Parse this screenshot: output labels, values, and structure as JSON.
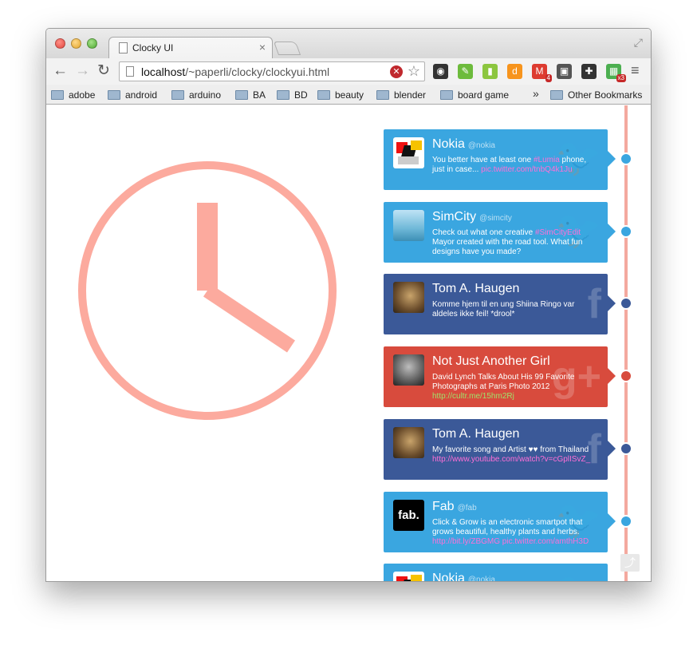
{
  "browser": {
    "tab_title": "Clocky UI",
    "url_host": "localhost",
    "url_path": "/~paperli/clocky/clockyui.html",
    "tab_close": "×",
    "nav": {
      "back": "←",
      "forward": "→",
      "reload": "↻"
    },
    "star": "☆",
    "more_bookmarks": "»"
  },
  "bookmarks": [
    "adobe",
    "android",
    "arduino",
    "BA",
    "BD",
    "beauty",
    "blender",
    "board game",
    "Other Bookmarks"
  ],
  "extensions": [
    {
      "name": "camera-icon",
      "color": "#333333",
      "glyph": "◉"
    },
    {
      "name": "evernote-feed-icon",
      "color": "#6dbb3c",
      "glyph": "✎"
    },
    {
      "name": "bar-icon",
      "color": "#8cc63f",
      "glyph": "▮"
    },
    {
      "name": "d-icon",
      "color": "#f7941d",
      "glyph": "d"
    },
    {
      "name": "gmail-icon",
      "color": "#dd3b30",
      "glyph": "M",
      "badge": "4"
    },
    {
      "name": "screenshot-icon",
      "color": "#555555",
      "glyph": "▣"
    },
    {
      "name": "puzzle-icon",
      "color": "#333333",
      "glyph": "✚"
    },
    {
      "name": "palette-icon",
      "color": "#4caf50",
      "glyph": "▦",
      "badge": "x3"
    }
  ],
  "clock": {
    "color": "#fcaa9e",
    "hour_angle": 135,
    "minute_angle": 0
  },
  "posts": [
    {
      "network": "twitter",
      "color": "#3aa6e0",
      "name": "Nokia",
      "handle": "@nokia",
      "text_before": "You better have at least one ",
      "text_hl": "#Lumia",
      "text_after": " phone, just in case... ",
      "link": "pic.twitter.com/tnbQ4k1Ju",
      "avatar": "nokia"
    },
    {
      "network": "twitter",
      "color": "#3aa6e0",
      "name": "SimCity",
      "handle": "@simcity",
      "text_before": "Check out what one creative ",
      "text_hl": "#SimCityEdit",
      "text_after": " Mayor created with the road tool. What fun designs have you made?",
      "link": "",
      "avatar": "simcity"
    },
    {
      "network": "facebook",
      "color": "#3b5998",
      "name": "Tom A. Haugen",
      "handle": "",
      "text_before": "Komme hjem til en ung Shiina Ringo var aldeles ikke feil! *drool*",
      "text_hl": "",
      "text_after": "",
      "link": "",
      "avatar": "tom"
    },
    {
      "network": "gplus",
      "color": "#d84b3d",
      "name": "Not Just Another Girl",
      "handle": "",
      "text_before": "David Lynch Talks About His 99 Favorite Photographs at Paris Photo 2012",
      "text_hl": "",
      "text_after": "",
      "link": "http://cultr.me/15hm2Rj",
      "avatar": "girl"
    },
    {
      "network": "facebook",
      "color": "#3b5998",
      "name": "Tom A. Haugen",
      "handle": "",
      "text_before": "My favorite song and Artist ♥♥ from Thailand",
      "text_hl": "",
      "text_after": "",
      "link": "http://www.youtube.com/watch?v=cGplISvZ_",
      "avatar": "tom"
    },
    {
      "network": "twitter",
      "color": "#3aa6e0",
      "name": "Fab",
      "handle": "@fab",
      "text_before": "Click & Grow is an electronic smartpot that grows beautiful, healthy plants and herbs.",
      "text_hl": "",
      "text_after": "",
      "link": "http://bit.ly/ZBGMG  pic.twitter.com/amthH3D",
      "avatar": "fab"
    },
    {
      "network": "twitter",
      "color": "#3aa6e0",
      "name": "Nokia",
      "handle": "@nokia",
      "text_before": "",
      "text_hl": "",
      "text_after": "",
      "link": "",
      "avatar": "nokia"
    }
  ],
  "colors": {
    "timeline": "#f4a99f",
    "link_green": "#9fe36b"
  }
}
